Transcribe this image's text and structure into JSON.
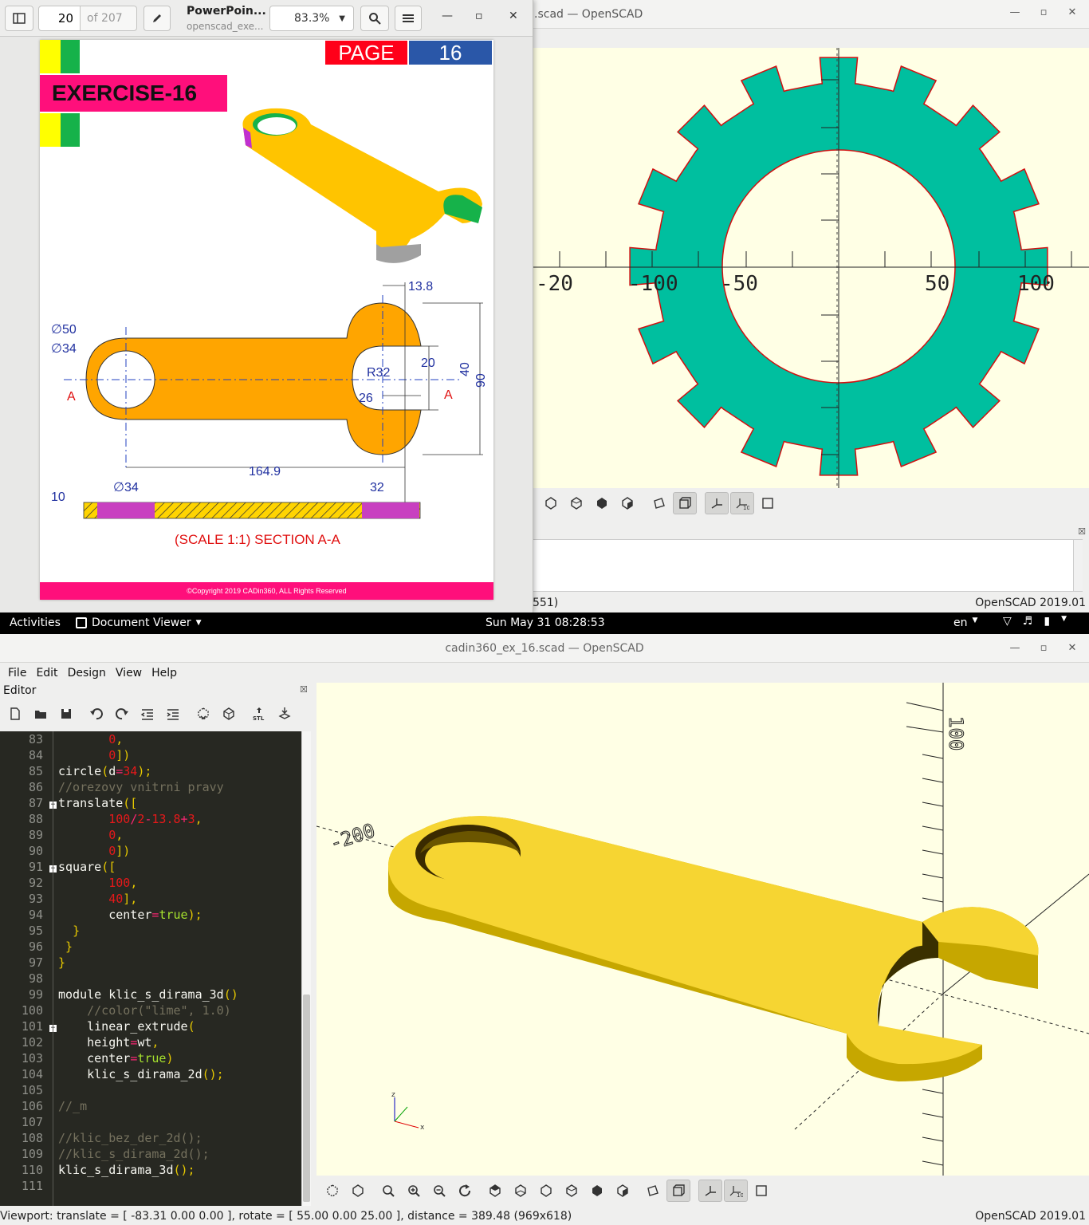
{
  "doc_viewer": {
    "page_number": "20",
    "page_total": "of 207",
    "title": "PowerPoin...",
    "subtitle": "openscad_exe...",
    "zoom": "83.3%",
    "page": {
      "page_label": "PAGE",
      "page_num": "16",
      "exercise": "EXERCISE-16",
      "dims": {
        "d50": "∅50",
        "d34": "∅34",
        "r32": "R32",
        "w13_8": "13.8",
        "w20": "20",
        "w40": "40",
        "w90": "90",
        "w26": "26",
        "len": "164.9",
        "thk": "10",
        "sec_d34": "∅34",
        "sec_32": "32",
        "sec_a_left": "A",
        "sec_a_right": "A"
      },
      "section_title": "(SCALE 1:1) SECTION A-A",
      "copyright": "©Copyright 2019 CADin360, ALL Rights Reserved"
    }
  },
  "osc_top": {
    "title": ".scad — OpenSCAD",
    "status_left": "551)",
    "status_right": "OpenSCAD 2019.01",
    "axis_labels": {
      "a": "-20",
      "b": "-50",
      "c": "50",
      "d": "–50",
      "e": "50",
      "f": "-50",
      "g": "-100",
      "h": "100"
    }
  },
  "gnome": {
    "activities": "Activities",
    "app": "Document Viewer",
    "clock": "Sun May 31  08:28:53",
    "lang": "en"
  },
  "osc_bot": {
    "title": "cadin360_ex_16.scad — OpenSCAD",
    "menu": [
      "File",
      "Edit",
      "Design",
      "View",
      "Help"
    ],
    "editor_label": "Editor",
    "line_numbers": [
      "83",
      "84",
      "85",
      "86",
      "87",
      "88",
      "89",
      "90",
      "91",
      "92",
      "93",
      "94",
      "95",
      "96",
      "97",
      "98",
      "99",
      "100",
      "101",
      "102",
      "103",
      "104",
      "105",
      "106",
      "107",
      "108",
      "109",
      "110",
      "111"
    ],
    "status": "Viewport: translate = [ -83.31 0.00 0.00 ], rotate = [ 55.00 0.00 25.00 ], distance = 389.48 (969x618)",
    "version": "OpenSCAD 2019.01",
    "axis_200": "-200",
    "axis_100": "100"
  }
}
